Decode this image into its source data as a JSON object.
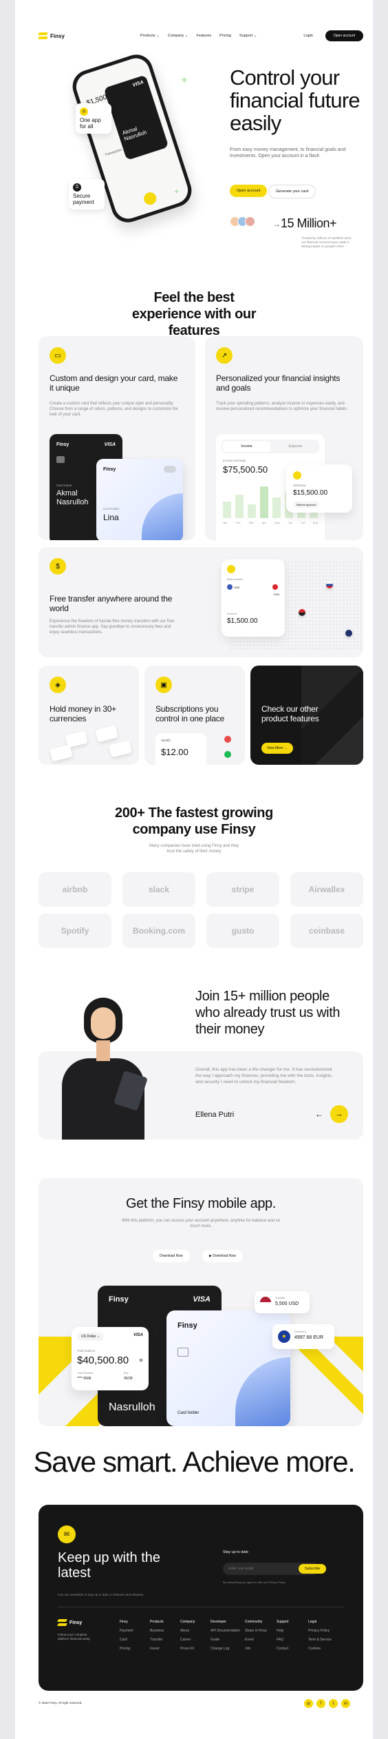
{
  "brand": {
    "name": "Finsy"
  },
  "nav": {
    "links": [
      "Products",
      "Company",
      "Features",
      "Pricing",
      "Support"
    ],
    "login": "Login",
    "cta": "Open account"
  },
  "hero": {
    "title": "Control your financial future easily",
    "subtitle": "From easy money management, to financial goals and investments. Open your account in a flash",
    "primary": "Open account",
    "secondary": "Generate your card",
    "stat": "15 Million+",
    "stat_sub": "Trusted by millions of satisfied users, our financial services have made a lasting impact on people's lives",
    "phone_tag1": "One app for all",
    "phone_tag2": "Secure payment",
    "phone_card_name": "Akmal Nasrulloh",
    "phone_card_brand": "VISA",
    "phone_balance": "$1,500",
    "phone_transaction": "Transaction"
  },
  "features": {
    "title": "Feel the best experience with our features",
    "card1": {
      "title": "Custom and design your card, make it unique",
      "desc": "Create a custom card that reflects your unique style and personality. Choose from a range of colors, patterns, and designs to customize the look of your card.",
      "dark_brand": "Finsy",
      "dark_visa": "VISA",
      "dark_label": "Card name",
      "dark_name": "Akmal Nasrulloh",
      "light_brand": "Finsy",
      "light_label": "Card holder",
      "light_name": "Lina"
    },
    "card2": {
      "title": "Personalized your financial insights and goals",
      "desc": "Track your spending patterns, analyze income or expenses easily, and receive personalized recommendations to optimize your financial habits.",
      "tab1": "Income",
      "tab2": "Expense",
      "label": "Income earnings",
      "amount": "$75,500.50",
      "sub_label": "Withdraw",
      "sub_amount": "$15,500.00",
      "sub_status": "Refund approve",
      "months": [
        "Jan",
        "Feb",
        "Mar",
        "Apr",
        "May",
        "Jun",
        "Jul",
        "Aug"
      ]
    },
    "card3": {
      "title": "Free transfer anywhere around the world",
      "desc": "Experience the freedom of hassle-free money transfers with our free transfer admin finance app. Say goodbye to unnecessary fees and enjoy seamless transactions.",
      "bank_label": "Bank transfer",
      "amount_label": "Amount",
      "amount": "$1,500.00",
      "currency1": "USD",
      "currency2": "CNA"
    },
    "card4": {
      "title": "Hold money in 30+ currencies"
    },
    "card5": {
      "title": "Subscriptions you control in one place",
      "service": "Spotify",
      "price": "$12.00"
    },
    "card6": {
      "title": "Check our other product features",
      "button": "View More"
    }
  },
  "logos": {
    "title": "200+ The fastest growing company use Finsy",
    "subtitle": "Many companies have tried using Finsy and they trust the safety of their money",
    "items": [
      "airbnb",
      "slack",
      "stripe",
      "Airwallex",
      "Spotify",
      "Booking.com",
      "gusto",
      "coinbase"
    ]
  },
  "testimonial": {
    "title": "Join 15+ million people who already trust us with their money",
    "quote": "Overall, this app has been a life-changer for me. It has revolutionized the way I approach my finances, providing me with the tools, insights, and security I need to unlock my financial freedom.",
    "author": "Ellena Putri"
  },
  "mobile": {
    "title": "Get the Finsy mobile app.",
    "subtitle": "With this platform, you can access your account anywhere, anytime for balance and so much more.",
    "store1": "Download Now",
    "store2": "Download Now",
    "currency_select": "US Dollar",
    "visa": "VISA",
    "balance_label": "Total balance",
    "balance": "$40,500.80",
    "card_label": "Card Number",
    "card_number": "**** 9508",
    "exp_label": "Exp",
    "exp": "05/28",
    "dark_brand": "Finsy",
    "dark_visa": "VISA",
    "dark_name": "Nasrulloh",
    "light_brand": "Finsy",
    "light_label": "Card holder",
    "usd_label": "Transfer",
    "usd_value": "5,500 USD",
    "eur_label": "Received",
    "eur_value": "4997.68 EUR"
  },
  "slogan": "Save smart. Achieve more.",
  "cta": {
    "title": "Keep up with the latest",
    "sub": "Join our newsletter to stay up to date on features and releases.",
    "newsletter_label": "Stay up to date",
    "placeholder": "Enter your email",
    "button": "Subscribe",
    "consent": "By subscribing you agree to with our Privacy Policy"
  },
  "footer": {
    "brand": "Finsy",
    "about": "Follow your complete platform financial easily",
    "cols": [
      {
        "title": "Finsy",
        "items": [
          "Payment",
          "Card",
          "Pricing"
        ]
      },
      {
        "title": "Products",
        "items": [
          "Business",
          "Transfer",
          "Invest"
        ]
      },
      {
        "title": "Company",
        "items": [
          "About",
          "Career",
          "Press Kit"
        ]
      },
      {
        "title": "Developer",
        "items": [
          "API Documentation",
          "Guide",
          "Change Log"
        ]
      },
      {
        "title": "Community",
        "items": [
          "Share in Finsy",
          "Event",
          "Job"
        ]
      },
      {
        "title": "Support",
        "items": [
          "Help",
          "FAQ",
          "Contact"
        ]
      },
      {
        "title": "Legal",
        "items": [
          "Privacy Policy",
          "Term & Service",
          "Cookies"
        ]
      }
    ],
    "copyright": "© 2023 Finsy. All right reserved."
  },
  "colors": {
    "accent": "#f5d90a",
    "dark": "#161616",
    "tile": "#f4f4f6"
  }
}
